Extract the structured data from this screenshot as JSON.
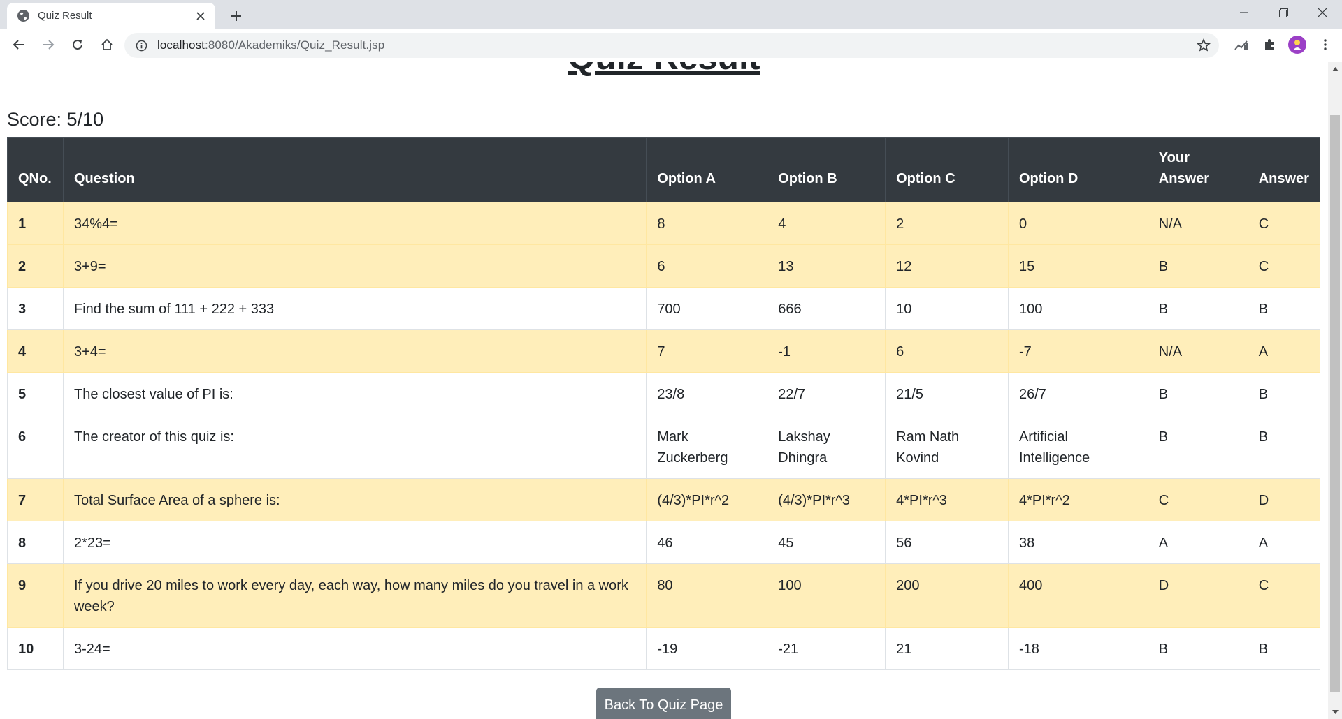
{
  "browser": {
    "tab_title": "Quiz Result",
    "url_host": "localhost",
    "url_rest": ":8080/Akademiks/Quiz_Result.jsp"
  },
  "page": {
    "title": "Quiz Result",
    "score_label": "Score: 5/10",
    "back_button": "Back To Quiz Page"
  },
  "table": {
    "headers": {
      "qno": "QNo.",
      "question": "Question",
      "option_a": "Option A",
      "option_b": "Option B",
      "option_c": "Option C",
      "option_d": "Option D",
      "your_answer_1": "Your",
      "your_answer_2": "Answer",
      "answer": "Answer"
    },
    "rows": [
      {
        "qno": "1",
        "question": "34%4=",
        "a": "8",
        "b": "4",
        "c": "2",
        "d": "0",
        "your": "N/A",
        "ans": "C"
      },
      {
        "qno": "2",
        "question": "3+9=",
        "a": "6",
        "b": "13",
        "c": "12",
        "d": "15",
        "your": "B",
        "ans": "C"
      },
      {
        "qno": "3",
        "question": "Find the sum of 111 + 222 + 333",
        "a": "700",
        "b": "666",
        "c": "10",
        "d": "100",
        "your": "B",
        "ans": "B"
      },
      {
        "qno": "4",
        "question": "3+4=",
        "a": "7",
        "b": "-1",
        "c": "6",
        "d": "-7",
        "your": "N/A",
        "ans": "A"
      },
      {
        "qno": "5",
        "question": "The closest value of PI is:",
        "a": "23/8",
        "b": "22/7",
        "c": "21/5",
        "d": "26/7",
        "your": "B",
        "ans": "B"
      },
      {
        "qno": "6",
        "question": "The creator of this quiz is:",
        "a": "Mark Zuckerberg",
        "b": "Lakshay Dhingra",
        "c": "Ram Nath Kovind",
        "d": "Artificial Intelligence",
        "your": "B",
        "ans": "B"
      },
      {
        "qno": "7",
        "question": "Total Surface Area of a sphere is:",
        "a": "(4/3)*PI*r^2",
        "b": "(4/3)*PI*r^3",
        "c": "4*PI*r^3",
        "d": "4*PI*r^2",
        "your": "C",
        "ans": "D"
      },
      {
        "qno": "8",
        "question": "2*23=",
        "a": "46",
        "b": "45",
        "c": "56",
        "d": "38",
        "your": "A",
        "ans": "A"
      },
      {
        "qno": "9",
        "question": "If you drive 20 miles to work every day, each way, how many miles do you travel in a work week?",
        "a": "80",
        "b": "100",
        "c": "200",
        "d": "400",
        "your": "D",
        "ans": "C"
      },
      {
        "qno": "10",
        "question": "3-24=",
        "a": "-19",
        "b": "-21",
        "c": "21",
        "d": "-18",
        "your": "B",
        "ans": "B"
      }
    ]
  },
  "colors": {
    "header_bg": "#343a40",
    "wrong_row_bg": "#ffeeba",
    "button_bg": "#6c757d"
  }
}
